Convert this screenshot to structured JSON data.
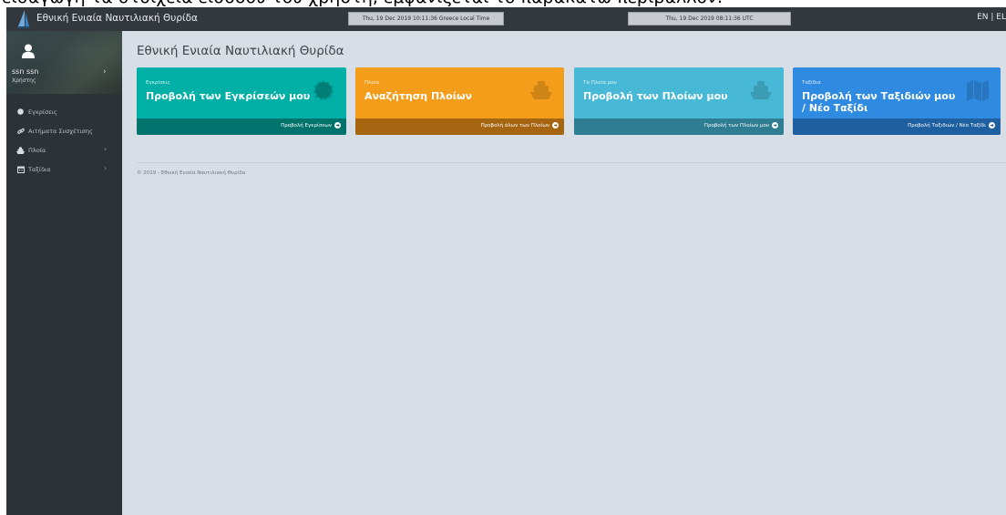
{
  "caption_cropped": "εισαγωγή τα στοιχεία εισόδου του χρήστη, εμφανίζεται το παρακάτω περιβάλλον:",
  "header": {
    "app_name": "Εθνική Ενιαία Ναυτιλιακή Θυρίδα",
    "local_time": "Thu, 19 Dec 2019 10:11:36 Greece Local Time",
    "utc_time": "Thu, 19 Dec 2019 08:11:36 UTC",
    "language": "EN | EL"
  },
  "sidebar": {
    "user": {
      "name": "ssn ssn",
      "role": "Χρήστης"
    },
    "items": [
      {
        "label": "Εγκρίσεις",
        "icon": "circle-icon",
        "has_submenu": false
      },
      {
        "label": "Αιτήματα Συσχέτισης",
        "icon": "link-icon",
        "has_submenu": false
      },
      {
        "label": "Πλοία",
        "icon": "ship-icon",
        "has_submenu": true
      },
      {
        "label": "Ταξίδια",
        "icon": "calendar-icon",
        "has_submenu": true
      }
    ]
  },
  "main": {
    "title": "Εθνική Ενιαία Ναυτιλιακή Θυρίδα",
    "cards": [
      {
        "label": "Εγκρίσεις",
        "title": "Προβολή των Εγκρίσεών μου",
        "link": "Προβολή Εγκρίσεων",
        "icon": "badge-icon",
        "color": "#00b0a6"
      },
      {
        "label": "Πλοία",
        "title": "Αναζήτηση Πλοίων",
        "link": "Προβολή όλων των Πλοίων",
        "icon": "ship-icon",
        "color": "#f39d1a"
      },
      {
        "label": "Τα Πλοία μου",
        "title": "Προβολή των Πλοίων μου",
        "link": "Προβολή των Πλοίων μου",
        "icon": "ship-icon",
        "color": "#47b8d6"
      },
      {
        "label": "Ταξίδια",
        "title": "Προβολή των Ταξιδιών μου / Νέο Ταξίδι",
        "link": "Προβολή Ταξιδιών / Νέο Ταξίδι",
        "icon": "map-icon",
        "color": "#2f8be2"
      }
    ],
    "footer": "© 2019 - Εθνική Ενιαία Ναυτιλιακή Θυρίδα"
  }
}
